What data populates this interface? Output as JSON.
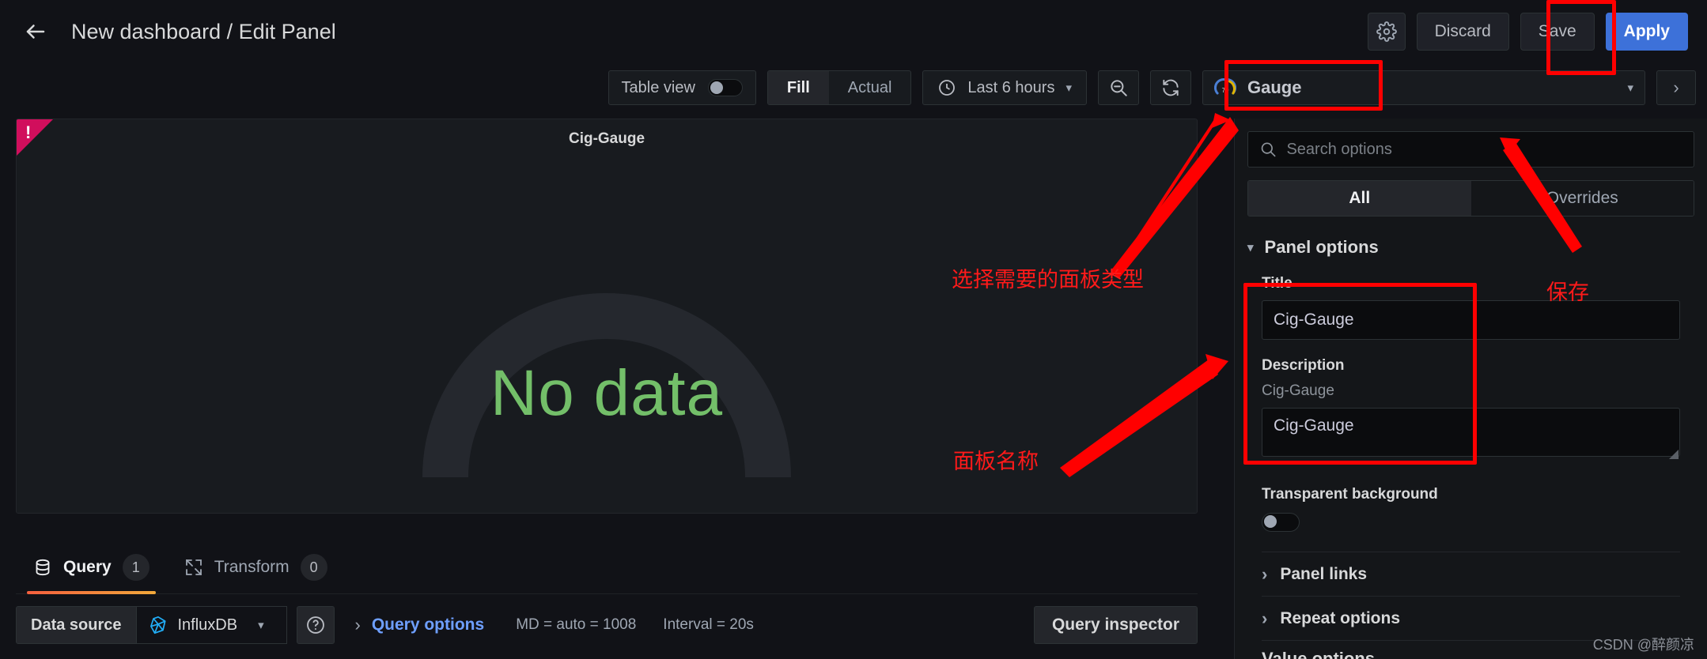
{
  "header": {
    "back_icon": "arrow-left-icon",
    "title": "New dashboard / Edit Panel",
    "settings_icon": "gear-icon",
    "discard_label": "Discard",
    "save_label": "Save",
    "apply_label": "Apply"
  },
  "toolbar": {
    "table_view_label": "Table view",
    "table_view_on": false,
    "fill_label": "Fill",
    "actual_label": "Actual",
    "active_fit": "Fill",
    "clock_icon": "clock-icon",
    "time_range": "Last 6 hours",
    "time_chevron_icon": "chevron-down-icon",
    "zoom_out_icon": "zoom-out-icon",
    "refresh_icon": "refresh-icon",
    "viz_icon": "gauge-icon",
    "viz_type": "Gauge",
    "viz_chevron_icon": "chevron-down-icon",
    "viz_expand_icon": "chevron-right-icon"
  },
  "panel": {
    "error_icon": "error-corner-icon",
    "error_mark": "!",
    "title": "Cig-Gauge",
    "no_data_text": "No data",
    "no_data_color": "#73bf69",
    "gauge_track_color": "#25282e"
  },
  "tabs": [
    {
      "icon": "database-icon",
      "label": "Query",
      "count": "1",
      "active": true
    },
    {
      "icon": "transform-icon",
      "label": "Transform",
      "count": "0",
      "active": false
    }
  ],
  "query": {
    "data_source_label": "Data source",
    "data_source_icon": "influxdb-icon",
    "data_source_value": "InfluxDB",
    "data_source_chevron_icon": "chevron-down-icon",
    "help_icon": "help-circle-icon",
    "query_options_chevron_icon": "chevron-right-icon",
    "query_options_label": "Query options",
    "md_text": "MD = auto = 1008",
    "interval_text": "Interval = 20s",
    "query_inspector_label": "Query inspector"
  },
  "options_pane": {
    "search_icon": "search-icon",
    "search_placeholder": "Search options",
    "search_value": "",
    "tabs": [
      {
        "label": "All",
        "active": true
      },
      {
        "label": "Overrides",
        "active": false
      }
    ],
    "panel_options": {
      "chevron_icon": "chevron-down-icon",
      "section_label": "Panel options",
      "title_label": "Title",
      "title_value": "Cig-Gauge",
      "description_label": "Description",
      "description_hint": "Cig-Gauge",
      "description_value": "Cig-Gauge",
      "transparent_label": "Transparent background",
      "transparent_on": false,
      "panel_links_label": "Panel links",
      "panel_links_icon": "chevron-right-icon",
      "repeat_options_label": "Repeat options",
      "repeat_options_icon": "chevron-right-icon",
      "next_section_label": "Value options"
    }
  },
  "annotations": {
    "accent_color": "#ff0000",
    "select_panel_type": "选择需要的面板类型",
    "panel_name": "面板名称",
    "save_note": "保存"
  },
  "watermark": "CSDN @醉颜凉"
}
